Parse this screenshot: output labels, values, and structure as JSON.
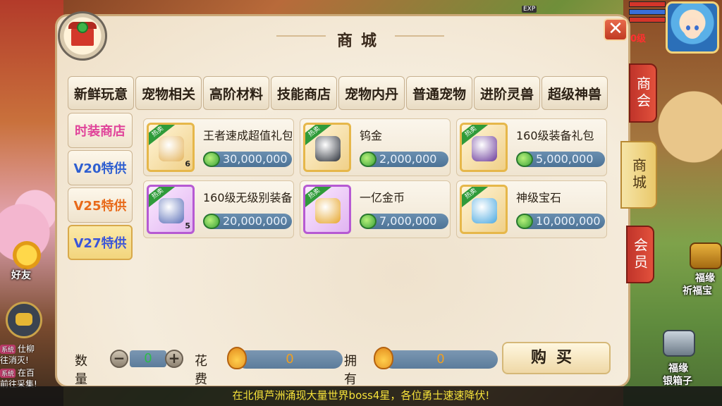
{
  "panel": {
    "title": "商城",
    "close_label": "✕"
  },
  "hud": {
    "exp_label": "EXP",
    "player_level": "0级"
  },
  "top_tabs": [
    "新鲜玩意",
    "宠物相关",
    "高阶材料",
    "技能商店",
    "宠物内丹",
    "普通宠物",
    "进阶灵兽",
    "超级神兽"
  ],
  "side_tabs": [
    {
      "label": "时装商店",
      "color": "#e0439a"
    },
    {
      "label": "V20特供",
      "color": "#2f5fd0"
    },
    {
      "label": "V25特供",
      "color": "#e86a1a"
    },
    {
      "label": "V27特供",
      "color": "#3b55d8",
      "active": true
    }
  ],
  "items": [
    {
      "name": "王者速成超值礼包",
      "price": "30,000,000",
      "badge": "热卖",
      "count": "6",
      "frame": "gold",
      "art_color": "#e4b35a"
    },
    {
      "name": "钨金",
      "price": "2,000,000",
      "badge": "热卖",
      "count": "",
      "frame": "gold",
      "art_color": "#2a2f38"
    },
    {
      "name": "160级装备礼包",
      "price": "5,000,000",
      "badge": "热卖",
      "count": "",
      "frame": "gold",
      "art_color": "#6a3a9a"
    },
    {
      "name": "160级无级别装备",
      "price": "20,000,000",
      "badge": "热卖",
      "count": "5",
      "frame": "purple",
      "art_color": "#5a6fb8"
    },
    {
      "name": "一亿金币",
      "price": "7,000,000",
      "badge": "热卖",
      "count": "",
      "frame": "purple",
      "art_color": "#e6a52a"
    },
    {
      "name": "神级宝石",
      "price": "10,000,000",
      "badge": "热卖",
      "count": "",
      "frame": "gold",
      "art_color": "#4aa8e0"
    }
  ],
  "bottom": {
    "qty_label": "数量",
    "qty_value": "0",
    "minus": "−",
    "plus": "+",
    "cost_label": "花费",
    "cost_value": "0",
    "own_label": "拥有",
    "own_value": "0",
    "buy_label": "购买"
  },
  "right_tabs": [
    "商会",
    "商城",
    "会员"
  ],
  "floating": {
    "friend_label": "好友",
    "chest1_label": "福缘\n祈福宝",
    "chest1_line1": "福缘",
    "chest1_line2": "祈福宝",
    "chest2_line1": "福缘",
    "chest2_line2": "银箱子"
  },
  "system_messages": [
    {
      "tag": "系统",
      "text": "仕柳"
    },
    {
      "tag": "",
      "text": "往消灭!"
    },
    {
      "tag": "系统",
      "text": "在百"
    },
    {
      "tag": "",
      "text": "前往采集!"
    }
  ],
  "marquee": "在北俱芦洲涌现大量世界boss4星，各位勇士速速降伏!"
}
